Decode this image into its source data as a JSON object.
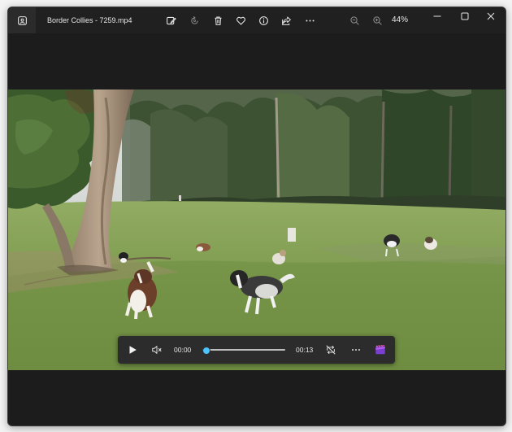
{
  "window": {
    "title": "Border Collies - 7259.mp4",
    "zoom": "44%"
  },
  "toolbar": {
    "icons": [
      "app-photos-icon",
      "edit-image-icon",
      "rotate-icon",
      "delete-icon",
      "favorite-heart-icon",
      "info-icon",
      "share-icon",
      "more-options-icon",
      "zoom-out-icon",
      "zoom-in-icon"
    ]
  },
  "window_controls": [
    "minimize-icon",
    "maximize-icon",
    "close-icon"
  ],
  "player": {
    "current_time": "00:00",
    "duration": "00:13",
    "progress": 0.0,
    "icons": [
      "play-icon",
      "mute-icon",
      "repeat-off-icon",
      "more-options-icon",
      "clipchamp-icon"
    ]
  },
  "colors": {
    "accent": "#4cc2ff",
    "window_bg": "#1c1c1c",
    "controls_bg": "#2c2c2c"
  }
}
